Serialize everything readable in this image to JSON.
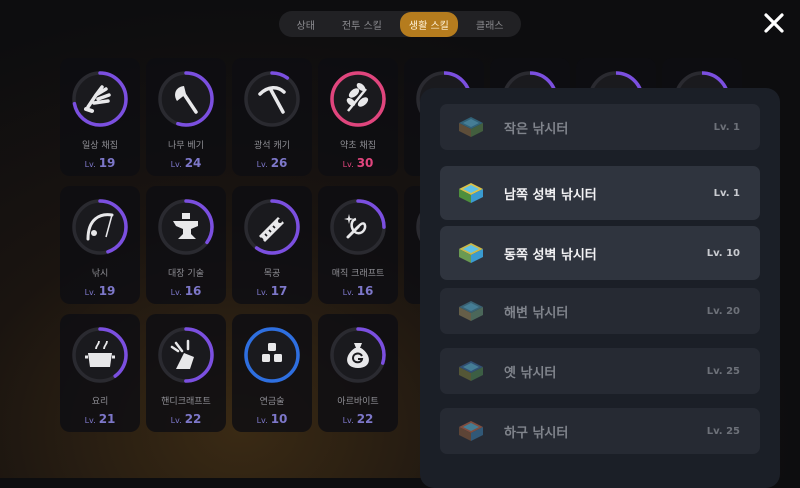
{
  "tabs": [
    "상태",
    "전투 스킬",
    "생활 스킬",
    "클래스"
  ],
  "active_tab": "생활 스킬",
  "level_prefix": "Lv.",
  "skills": [
    {
      "name": "일상 채집",
      "level": "19",
      "icon": "hand-gather-icon",
      "progress": 0.72
    },
    {
      "name": "나무 베기",
      "level": "24",
      "icon": "axe-icon",
      "progress": 0.55
    },
    {
      "name": "광석 캐기",
      "level": "26",
      "icon": "pickaxe-icon",
      "progress": 0.1
    },
    {
      "name": "약초 채집",
      "level": "30",
      "icon": "herb-icon",
      "progress": 1.0,
      "highlight": true
    },
    {
      "name": "낚시",
      "level": "19",
      "icon": "fishing-rod-icon",
      "progress": 0.45
    },
    {
      "name": "대장 기술",
      "level": "16",
      "icon": "anvil-icon",
      "progress": 0.35
    },
    {
      "name": "목공",
      "level": "17",
      "icon": "saw-icon",
      "progress": 0.6
    },
    {
      "name": "매직 크래프트",
      "level": "16",
      "icon": "magic-craft-icon",
      "progress": 0.25
    },
    {
      "name": "요리",
      "level": "21",
      "icon": "cooking-pot-icon",
      "progress": 0.4
    },
    {
      "name": "핸디크래프트",
      "level": "22",
      "icon": "handicraft-icon",
      "progress": 0.5
    },
    {
      "name": "연금술",
      "level": "10",
      "icon": "alchemy-blocks-icon",
      "progress": 1.0,
      "blue": true
    },
    {
      "name": "아르바이트",
      "level": "22",
      "icon": "money-bag-icon",
      "progress": 0.3
    }
  ],
  "fishing_spots": [
    {
      "name": "작은 낚시터",
      "level": "Lv. 1",
      "icon": "small-pond-icon"
    },
    {
      "name": "남쪽 성벽 낚시터",
      "level": "Lv. 1",
      "icon": "south-wall-pond-icon"
    },
    {
      "name": "동쪽 성벽 낚시터",
      "level": "Lv. 10",
      "icon": "east-wall-pond-icon"
    },
    {
      "name": "해변 낚시터",
      "level": "Lv. 20",
      "icon": "beach-pond-icon"
    },
    {
      "name": "옛 낚시터",
      "level": "Lv. 25",
      "icon": "old-pond-icon"
    },
    {
      "name": "하구 낚시터",
      "level": "Lv. 25",
      "icon": "estuary-pond-icon"
    }
  ],
  "colors": {
    "accent": "#b57c1e",
    "progress_purple": "#7b4fe0",
    "herb_pink": "#e0457d",
    "alchemy_blue": "#2e6fe0"
  }
}
